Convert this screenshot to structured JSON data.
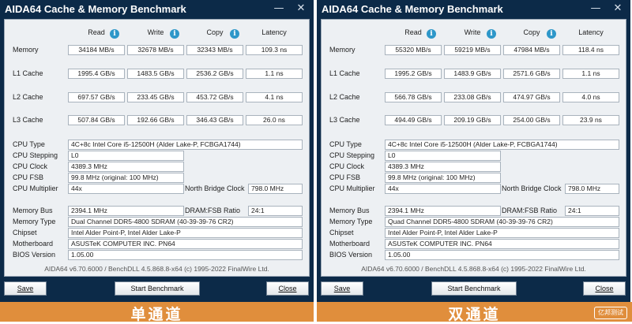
{
  "common": {
    "title": "AIDA64 Cache & Memory Benchmark",
    "minimize_glyph": "—",
    "close_glyph": "✕",
    "columns": {
      "read": "Read",
      "write": "Write",
      "copy": "Copy",
      "latency": "Latency"
    },
    "info_glyph": "i",
    "row_labels": {
      "memory": "Memory",
      "l1": "L1 Cache",
      "l2": "L2 Cache",
      "l3": "L3 Cache"
    },
    "info_labels": {
      "cpu_type": "CPU Type",
      "cpu_stepping": "CPU Stepping",
      "cpu_clock": "CPU Clock",
      "cpu_fsb": "CPU FSB",
      "cpu_multiplier": "CPU Multiplier",
      "north_bridge_clock": "North Bridge Clock",
      "memory_bus": "Memory Bus",
      "dram_fsb_ratio": "DRAM:FSB Ratio",
      "memory_type": "Memory Type",
      "chipset": "Chipset",
      "motherboard": "Motherboard",
      "bios_version": "BIOS Version"
    },
    "footer": "AIDA64 v6.70.6000 / BenchDLL 4.5.868.8-x64  (c) 1995-2022 FinalWire Ltd.",
    "buttons": {
      "save": "Save",
      "start": "Start Benchmark",
      "close": "Close"
    },
    "colors": {
      "window": "#0c2a48",
      "panel": "#edf0f3",
      "info_icon": "#2e97c9",
      "banner": "#e08e3c"
    }
  },
  "left": {
    "banner": "单通道",
    "memory": {
      "read": "34184 MB/s",
      "write": "32678 MB/s",
      "copy": "32343 MB/s",
      "latency": "109.3 ns"
    },
    "l1": {
      "read": "1995.4 GB/s",
      "write": "1483.5 GB/s",
      "copy": "2536.2 GB/s",
      "latency": "1.1 ns"
    },
    "l2": {
      "read": "697.57 GB/s",
      "write": "233.45 GB/s",
      "copy": "453.72 GB/s",
      "latency": "4.1 ns"
    },
    "l3": {
      "read": "507.84 GB/s",
      "write": "192.66 GB/s",
      "copy": "346.43 GB/s",
      "latency": "26.0 ns"
    },
    "info": {
      "cpu_type": "4C+8c Intel Core i5-12500H  (Alder Lake-P, FCBGA1744)",
      "cpu_stepping": "L0",
      "cpu_clock": "4389.3 MHz",
      "cpu_fsb": "99.8 MHz  (original: 100 MHz)",
      "cpu_multiplier": "44x",
      "north_bridge_clock": "798.0 MHz",
      "memory_bus": "2394.1 MHz",
      "dram_fsb_ratio": "24:1",
      "memory_type": "Dual Channel DDR5-4800 SDRAM  (40-39-39-76 CR2)",
      "chipset": "Intel Alder Point-P, Intel Alder Lake-P",
      "motherboard": "ASUSTeK COMPUTER INC. PN64",
      "bios_version": "1.05.00"
    }
  },
  "right": {
    "banner": "双通道",
    "watermark": "亿邦测试",
    "memory": {
      "read": "55320 MB/s",
      "write": "59219 MB/s",
      "copy": "47984 MB/s",
      "latency": "118.4 ns"
    },
    "l1": {
      "read": "1995.2 GB/s",
      "write": "1483.9 GB/s",
      "copy": "2571.6 GB/s",
      "latency": "1.1 ns"
    },
    "l2": {
      "read": "566.78 GB/s",
      "write": "233.08 GB/s",
      "copy": "474.97 GB/s",
      "latency": "4.0 ns"
    },
    "l3": {
      "read": "494.49 GB/s",
      "write": "209.19 GB/s",
      "copy": "254.00 GB/s",
      "latency": "23.9 ns"
    },
    "info": {
      "cpu_type": "4C+8c Intel Core i5-12500H  (Alder Lake-P, FCBGA1744)",
      "cpu_stepping": "L0",
      "cpu_clock": "4389.3 MHz",
      "cpu_fsb": "99.8 MHz  (original: 100 MHz)",
      "cpu_multiplier": "44x",
      "north_bridge_clock": "798.0 MHz",
      "memory_bus": "2394.1 MHz",
      "dram_fsb_ratio": "24:1",
      "memory_type": "Quad Channel DDR5-4800 SDRAM  (40-39-39-76 CR2)",
      "chipset": "Intel Alder Point-P, Intel Alder Lake-P",
      "motherboard": "ASUSTeK COMPUTER INC. PN64",
      "bios_version": "1.05.00"
    }
  }
}
